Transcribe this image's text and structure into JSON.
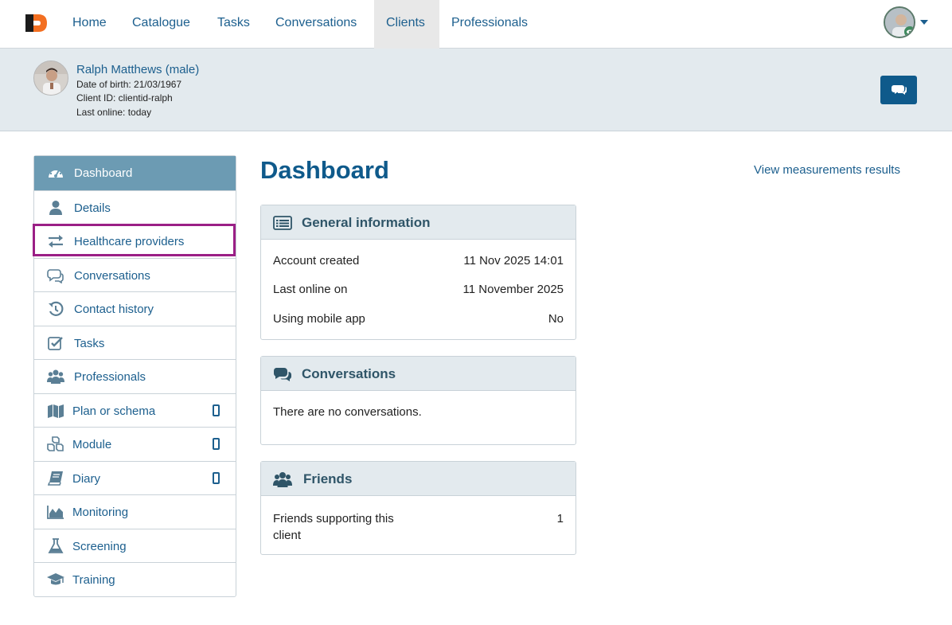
{
  "nav": {
    "items": [
      "Home",
      "Catalogue",
      "Tasks",
      "Conversations",
      "Clients",
      "Professionals"
    ],
    "active": "Clients"
  },
  "client": {
    "name": "Ralph Matthews (male)",
    "dob": "Date of birth: 21/03/1967",
    "client_id": "Client ID: clientid-ralph",
    "last_online": "Last online: today"
  },
  "sidebar": {
    "items": [
      {
        "label": "Dashboard",
        "icon": "dashboard-icon"
      },
      {
        "label": "Details",
        "icon": "user-icon"
      },
      {
        "label": "Healthcare providers",
        "icon": "exchange-icon"
      },
      {
        "label": "Conversations",
        "icon": "comments-icon"
      },
      {
        "label": "Contact history",
        "icon": "history-icon"
      },
      {
        "label": "Tasks",
        "icon": "check-square-icon"
      },
      {
        "label": "Professionals",
        "icon": "users-icon"
      },
      {
        "label": "Plan or schema",
        "icon": "map-icon"
      },
      {
        "label": "Module",
        "icon": "cubes-icon"
      },
      {
        "label": "Diary",
        "icon": "book-icon"
      },
      {
        "label": "Monitoring",
        "icon": "area-chart-icon"
      },
      {
        "label": "Screening",
        "icon": "flask-icon"
      },
      {
        "label": "Training",
        "icon": "graduation-cap-icon"
      }
    ]
  },
  "main": {
    "title": "Dashboard",
    "view_link": "View measurements results",
    "general": {
      "title": "General information",
      "rows": [
        {
          "label": "Account created",
          "value": "11 Nov 2025 14:01"
        },
        {
          "label": "Last online on",
          "value": "11 November 2025"
        },
        {
          "label": "Using mobile app",
          "value": "No"
        }
      ]
    },
    "conversations": {
      "title": "Conversations",
      "text": "There are no conversations."
    },
    "friends": {
      "title": "Friends",
      "label_line1": "Friends supporting this",
      "label_line2": "client",
      "value": "1"
    }
  },
  "colors": {
    "brand_blue": "#0f5a8b",
    "link_blue": "#1c5f8e",
    "sidebar_active": "#6c9bb3",
    "highlight": "#9b1f86",
    "logo_orange": "#f36f21"
  }
}
